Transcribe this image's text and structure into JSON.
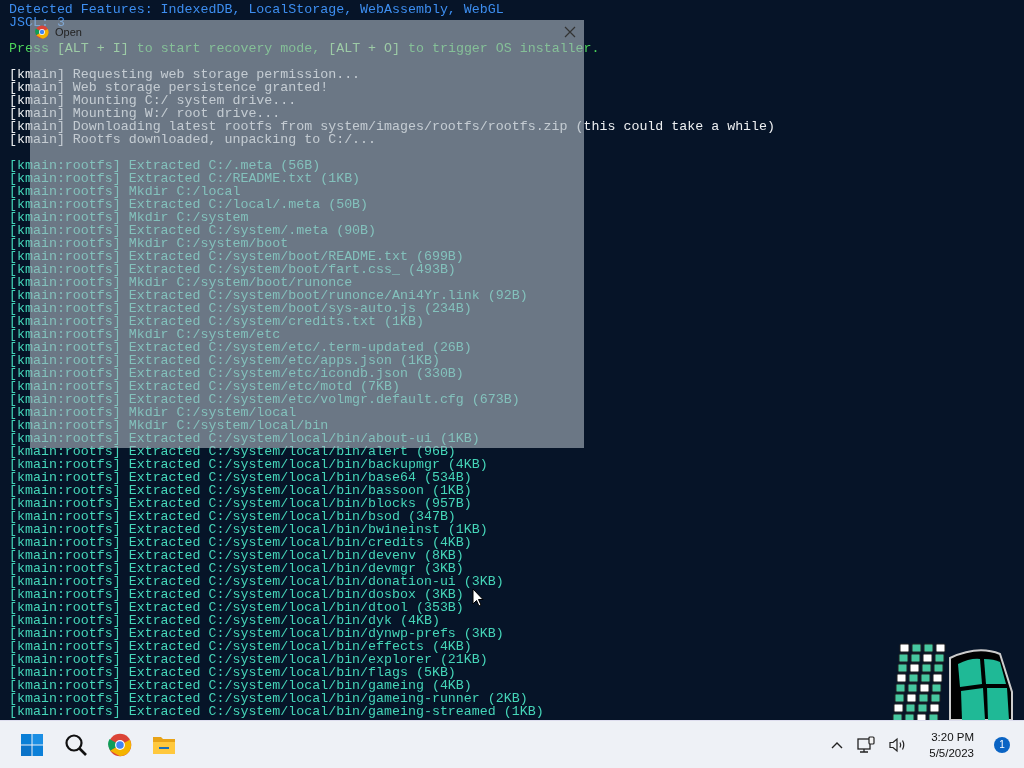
{
  "terminal": {
    "lines": [
      {
        "kind": "info",
        "text": "Detected Features: IndexedDB, LocalStorage, WebAssembly, WebGL"
      },
      {
        "kind": "info",
        "text": "JSCL: 3"
      },
      {
        "kind": "blank"
      },
      {
        "kind": "prompt",
        "text": "Press **[ALT + I]** to start recovery mode, **[ALT + O]** to trigger OS installer."
      },
      {
        "kind": "blank"
      },
      {
        "kind": "log",
        "text": "[kmain] Requesting web storage permission..."
      },
      {
        "kind": "log",
        "text": "[kmain] Web storage persistence granted!"
      },
      {
        "kind": "log",
        "text": "[kmain] Mounting C:/ system drive..."
      },
      {
        "kind": "log",
        "text": "[kmain] Mounting W:/ root drive..."
      },
      {
        "kind": "log",
        "text": "[kmain] Downloading latest rootfs from system/images/rootfs/rootfs.zip (this could take a while)"
      },
      {
        "kind": "log",
        "text": "[kmain] Rootfs downloaded, unpacking to C:/..."
      },
      {
        "kind": "blank"
      },
      {
        "kind": "rootfs",
        "text": "[kmain:rootfs] Extracted C:/.meta (56B)"
      },
      {
        "kind": "rootfs",
        "text": "[kmain:rootfs] Extracted C:/README.txt (1KB)"
      },
      {
        "kind": "rootfs",
        "text": "[kmain:rootfs] Mkdir C:/local"
      },
      {
        "kind": "rootfs",
        "text": "[kmain:rootfs] Extracted C:/local/.meta (50B)"
      },
      {
        "kind": "rootfs",
        "text": "[kmain:rootfs] Mkdir C:/system"
      },
      {
        "kind": "rootfs",
        "text": "[kmain:rootfs] Extracted C:/system/.meta (90B)"
      },
      {
        "kind": "rootfs",
        "text": "[kmain:rootfs] Mkdir C:/system/boot"
      },
      {
        "kind": "rootfs",
        "text": "[kmain:rootfs] Extracted C:/system/boot/README.txt (699B)"
      },
      {
        "kind": "rootfs",
        "text": "[kmain:rootfs] Extracted C:/system/boot/fart.css_ (493B)"
      },
      {
        "kind": "rootfs",
        "text": "[kmain:rootfs] Mkdir C:/system/boot/runonce"
      },
      {
        "kind": "rootfs",
        "text": "[kmain:rootfs] Extracted C:/system/boot/runonce/Ani4Yr.link (92B)"
      },
      {
        "kind": "rootfs",
        "text": "[kmain:rootfs] Extracted C:/system/boot/sys-auto.js (234B)"
      },
      {
        "kind": "rootfs",
        "text": "[kmain:rootfs] Extracted C:/system/credits.txt (1KB)"
      },
      {
        "kind": "rootfs",
        "text": "[kmain:rootfs] Mkdir C:/system/etc"
      },
      {
        "kind": "rootfs",
        "text": "[kmain:rootfs] Extracted C:/system/etc/.term-updated (26B)"
      },
      {
        "kind": "rootfs",
        "text": "[kmain:rootfs] Extracted C:/system/etc/apps.json (1KB)"
      },
      {
        "kind": "rootfs",
        "text": "[kmain:rootfs] Extracted C:/system/etc/icondb.json (330B)"
      },
      {
        "kind": "rootfs",
        "text": "[kmain:rootfs] Extracted C:/system/etc/motd (7KB)"
      },
      {
        "kind": "rootfs",
        "text": "[kmain:rootfs] Extracted C:/system/etc/volmgr.default.cfg (673B)"
      },
      {
        "kind": "rootfs",
        "text": "[kmain:rootfs] Mkdir C:/system/local"
      },
      {
        "kind": "rootfs",
        "text": "[kmain:rootfs] Mkdir C:/system/local/bin"
      },
      {
        "kind": "rootfs",
        "text": "[kmain:rootfs] Extracted C:/system/local/bin/about-ui (1KB)"
      },
      {
        "kind": "rootfs",
        "text": "[kmain:rootfs] Extracted C:/system/local/bin/alert (96B)"
      },
      {
        "kind": "rootfs",
        "text": "[kmain:rootfs] Extracted C:/system/local/bin/backupmgr (4KB)"
      },
      {
        "kind": "rootfs",
        "text": "[kmain:rootfs] Extracted C:/system/local/bin/base64 (534B)"
      },
      {
        "kind": "rootfs",
        "text": "[kmain:rootfs] Extracted C:/system/local/bin/bassoon (1KB)"
      },
      {
        "kind": "rootfs",
        "text": "[kmain:rootfs] Extracted C:/system/local/bin/blocks (957B)"
      },
      {
        "kind": "rootfs",
        "text": "[kmain:rootfs] Extracted C:/system/local/bin/bsod (347B)"
      },
      {
        "kind": "rootfs",
        "text": "[kmain:rootfs] Extracted C:/system/local/bin/bwineinst (1KB)"
      },
      {
        "kind": "rootfs",
        "text": "[kmain:rootfs] Extracted C:/system/local/bin/credits (4KB)"
      },
      {
        "kind": "rootfs",
        "text": "[kmain:rootfs] Extracted C:/system/local/bin/devenv (8KB)"
      },
      {
        "kind": "rootfs",
        "text": "[kmain:rootfs] Extracted C:/system/local/bin/devmgr (3KB)"
      },
      {
        "kind": "rootfs",
        "text": "[kmain:rootfs] Extracted C:/system/local/bin/donation-ui (3KB)"
      },
      {
        "kind": "rootfs",
        "text": "[kmain:rootfs] Extracted C:/system/local/bin/dosbox (3KB)"
      },
      {
        "kind": "rootfs",
        "text": "[kmain:rootfs] Extracted C:/system/local/bin/dtool (353B)"
      },
      {
        "kind": "rootfs",
        "text": "[kmain:rootfs] Extracted C:/system/local/bin/dyk (4KB)"
      },
      {
        "kind": "rootfs",
        "text": "[kmain:rootfs] Extracted C:/system/local/bin/dynwp-prefs (3KB)"
      },
      {
        "kind": "rootfs",
        "text": "[kmain:rootfs] Extracted C:/system/local/bin/effects (4KB)"
      },
      {
        "kind": "rootfs",
        "text": "[kmain:rootfs] Extracted C:/system/local/bin/explorer (21KB)"
      },
      {
        "kind": "rootfs",
        "text": "[kmain:rootfs] Extracted C:/system/local/bin/flags (5KB)"
      },
      {
        "kind": "rootfs",
        "text": "[kmain:rootfs] Extracted C:/system/local/bin/gameing (4KB)"
      },
      {
        "kind": "rootfs",
        "text": "[kmain:rootfs] Extracted C:/system/local/bin/gameing-runner (2KB)"
      },
      {
        "kind": "rootfs",
        "text": "[kmain:rootfs] Extracted C:/system/local/bin/gameing-streamed (1KB)"
      }
    ]
  },
  "dialog": {
    "title": "Open"
  },
  "taskbar": {
    "apps": [
      {
        "kind": "start"
      },
      {
        "kind": "search"
      },
      {
        "kind": "chrome"
      },
      {
        "kind": "folder"
      }
    ],
    "clock": {
      "time": "3:20 PM",
      "date": "5/5/2023"
    },
    "notifications": "1"
  }
}
